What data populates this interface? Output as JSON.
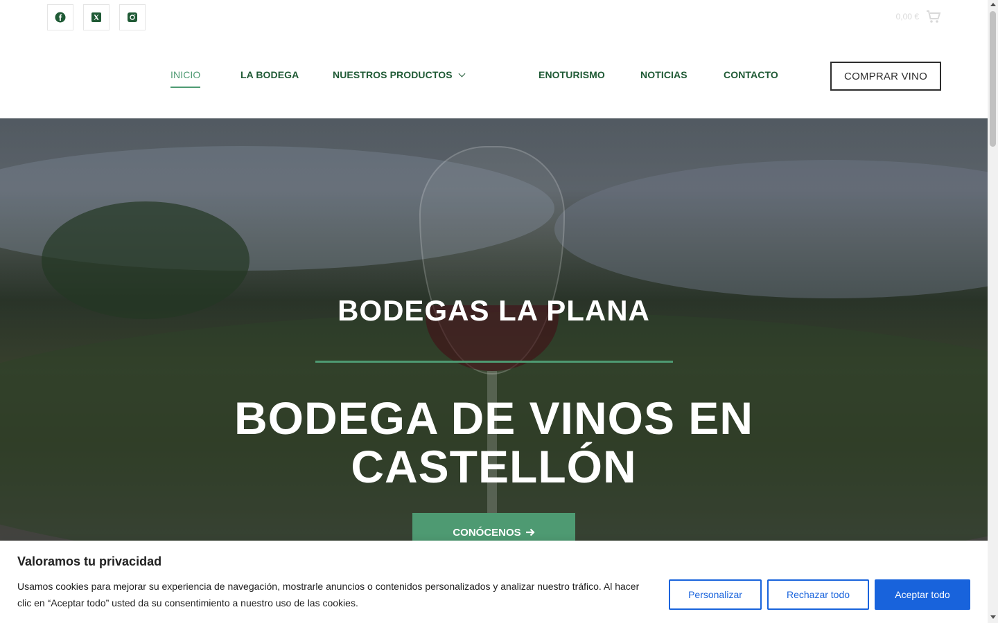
{
  "social": {
    "facebook_icon": "facebook-icon",
    "x_icon": "x-twitter-icon",
    "instagram_icon": "instagram-icon"
  },
  "cart": {
    "total": "0,00 €",
    "icon": "cart-icon"
  },
  "nav": {
    "items": [
      {
        "label": "INICIO"
      },
      {
        "label": "LA BODEGA"
      },
      {
        "label": "NUESTROS PRODUCTOS"
      },
      {
        "label": "ENOTURISMO"
      },
      {
        "label": "NOTICIAS"
      },
      {
        "label": "CONTACTO"
      }
    ],
    "buy_label": "COMPRAR VINO"
  },
  "hero": {
    "subtitle": "BODEGAS LA PLANA",
    "title_line1": "BODEGA DE VINOS EN",
    "title_line2": "CASTELLÓN",
    "button_label": "CONÓCENOS"
  },
  "cookie": {
    "title": "Valoramos tu privacidad",
    "text": "Usamos cookies para mejorar su experiencia de navegación, mostrarle anuncios o contenidos personalizados y analizar nuestro tráfico. Al hacer clic en “Aceptar todo” usted da su consentimiento a nuestro uso de las cookies.",
    "customize_label": "Personalizar",
    "reject_label": "Rechazar todo",
    "accept_label": "Aceptar todo"
  },
  "colors": {
    "brand_green": "#1f5a35",
    "accent_green": "#4e9a72",
    "cookie_blue": "#1863dc"
  }
}
